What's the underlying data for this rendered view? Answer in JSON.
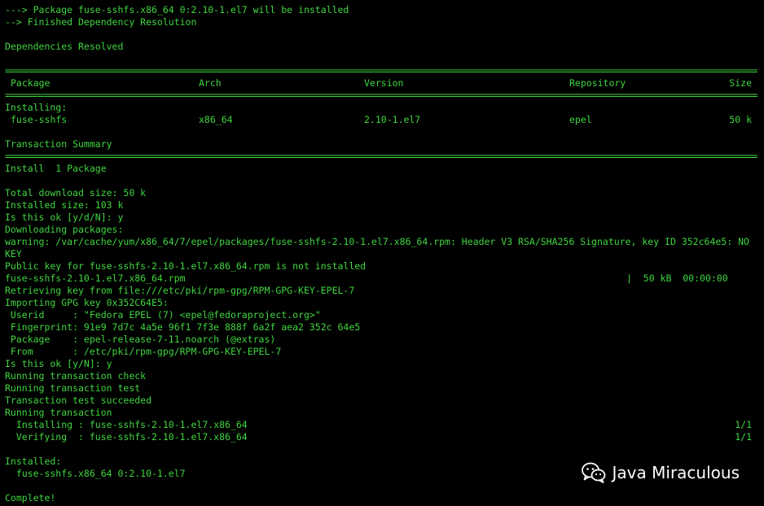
{
  "terminal": {
    "colors": {
      "background": "#000000",
      "text": "#3fd53f",
      "watermark": "#ffffff"
    },
    "lines": {
      "l1": "---> Package fuse-sshfs.x86_64 0:2.10-1.el7 will be installed",
      "l2": "--> Finished Dependency Resolution",
      "l3": "Dependencies Resolved",
      "install_heading": "Installing:",
      "summary_heading": "Transaction Summary",
      "install_count": "Install  1 Package",
      "download_size": "Total download size: 50 k",
      "installed_size": "Installed size: 103 k",
      "prompt1": "Is this ok [y/d/N]: y",
      "downloading": "Downloading packages:",
      "warning1": "warning: /var/cache/yum/x86_64/7/epel/packages/fuse-sshfs-2.10-1.el7.x86_64.rpm: Header V3 RSA/SHA256 Signature, key ID 352c64e5: NO",
      "warning2": "KEY",
      "pubkey": "Public key for fuse-sshfs-2.10-1.el7.x86_64.rpm is not installed",
      "rpm_file": "fuse-sshfs-2.10-1.el7.x86_64.rpm",
      "rpm_progress": "|  50 kB  00:00:00",
      "retrieving": "Retrieving key from file:///etc/pki/rpm-gpg/RPM-GPG-KEY-EPEL-7",
      "importing": "Importing GPG key 0x352C64E5:",
      "userid": " Userid     : \"Fedora EPEL (7) <epel@fedoraproject.org>\"",
      "fingerprint": " Fingerprint: 91e9 7d7c 4a5e 96f1 7f3e 888f 6a2f aea2 352c 64e5",
      "package": " Package    : epel-release-7-11.noarch (@extras)",
      "from": " From       : /etc/pki/rpm-gpg/RPM-GPG-KEY-EPEL-7",
      "prompt2": "Is this ok [y/N]: y",
      "check": "Running transaction check",
      "test": "Running transaction test",
      "test_ok": "Transaction test succeeded",
      "running": "Running transaction",
      "installing_step": "  Installing : fuse-sshfs-2.10-1.el7.x86_64",
      "installing_count": "1/1",
      "verifying_step": "  Verifying  : fuse-sshfs-2.10-1.el7.x86_64",
      "verifying_count": "1/1",
      "installed_heading": "Installed:",
      "installed_pkg": "  fuse-sshfs.x86_64 0:2.10-1.el7",
      "complete": "Complete!"
    },
    "rule": "=============================================================================================================================================================================",
    "table": {
      "headers": {
        "package": "Package",
        "arch": "Arch",
        "version": "Version",
        "repository": "Repository",
        "size": "Size"
      },
      "row": {
        "package": "fuse-sshfs",
        "arch": "x86_64",
        "version": "2.10-1.el7",
        "repository": "epel",
        "size": "50 k"
      }
    }
  },
  "watermark": {
    "icon": "wechat-icon",
    "label": "Java Miraculous"
  }
}
